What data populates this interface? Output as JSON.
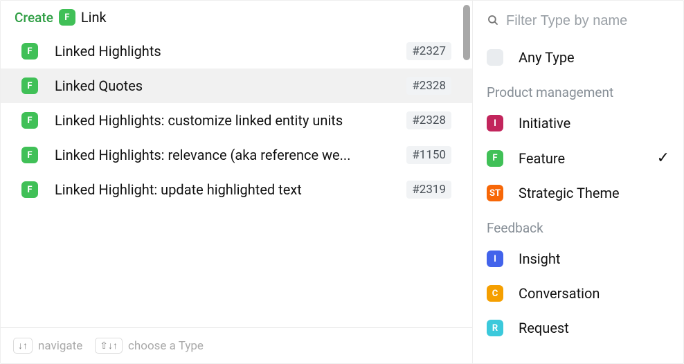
{
  "colors": {
    "green": "#40c057",
    "pink": "#c2255c",
    "orange": "#f76707",
    "blue": "#4263eb",
    "amber": "#f59f00",
    "teal": "#3bc9db",
    "grey": "#e9ecef"
  },
  "create": {
    "label": "Create",
    "badge_letter": "F",
    "text": "Link"
  },
  "results": [
    {
      "badge_letter": "F",
      "title": "Linked Highlights",
      "id": "#2327",
      "selected": false
    },
    {
      "badge_letter": "F",
      "title": "Linked Quotes",
      "id": "#2328",
      "selected": true
    },
    {
      "badge_letter": "F",
      "title": "Linked Highlights: customize linked entity units",
      "id": "#2328",
      "selected": false
    },
    {
      "badge_letter": "F",
      "title": "Linked Highlights: relevance (aka reference we...",
      "id": "#1150",
      "selected": false
    },
    {
      "badge_letter": "F",
      "title": "Linked Highlight: update highlighted text",
      "id": "#2319",
      "selected": false
    }
  ],
  "hints": {
    "navigate_keys": "↓↑",
    "navigate_label": "navigate",
    "type_keys": "⇧↓↑",
    "type_label": "choose a Type"
  },
  "filter": {
    "placeholder": "Filter Type by name"
  },
  "type_any": {
    "label": "Any Type"
  },
  "sections": [
    {
      "label": "Product management",
      "items": [
        {
          "badge": "I",
          "color": "pink",
          "label": "Initiative",
          "checked": false
        },
        {
          "badge": "F",
          "color": "green",
          "label": "Feature",
          "checked": true
        },
        {
          "badge": "ST",
          "color": "orange",
          "label": "Strategic Theme",
          "checked": false
        }
      ]
    },
    {
      "label": "Feedback",
      "items": [
        {
          "badge": "I",
          "color": "blue",
          "label": "Insight",
          "checked": false
        },
        {
          "badge": "C",
          "color": "amber",
          "label": "Conversation",
          "checked": false
        },
        {
          "badge": "R",
          "color": "teal",
          "label": "Request",
          "checked": false
        }
      ]
    }
  ]
}
